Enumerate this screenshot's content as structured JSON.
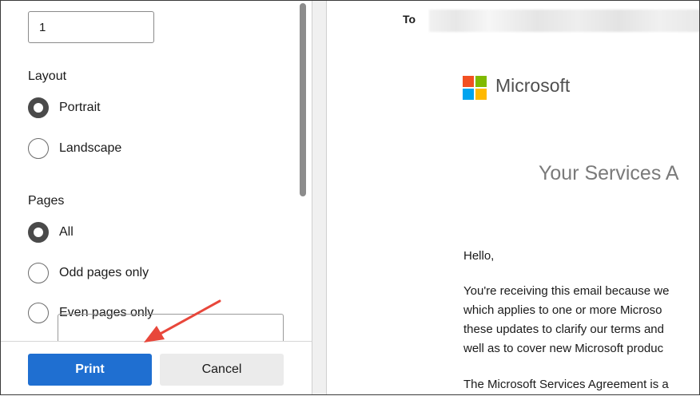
{
  "settings": {
    "copies_value": "1",
    "layout": {
      "title": "Layout",
      "options": [
        {
          "label": "Portrait",
          "checked": true
        },
        {
          "label": "Landscape",
          "checked": false
        }
      ]
    },
    "pages": {
      "title": "Pages",
      "options": [
        {
          "label": "All",
          "checked": true
        },
        {
          "label": "Odd pages only",
          "checked": false
        },
        {
          "label": "Even pages only",
          "checked": false
        }
      ]
    },
    "buttons": {
      "print": "Print",
      "cancel": "Cancel"
    },
    "colors": {
      "primary": "#1f6fd1",
      "annotation_arrow": "#e8473b"
    }
  },
  "preview": {
    "to_label": "To",
    "brand_name": "Microsoft",
    "title": "Your Services A",
    "greeting": "Hello,",
    "body_lines": [
      "You're receiving this email because we",
      "which applies to one or more Microso",
      "these updates to clarify our terms and",
      "well as to cover new Microsoft produc",
      "The Microsoft Services Agreement is a"
    ]
  }
}
